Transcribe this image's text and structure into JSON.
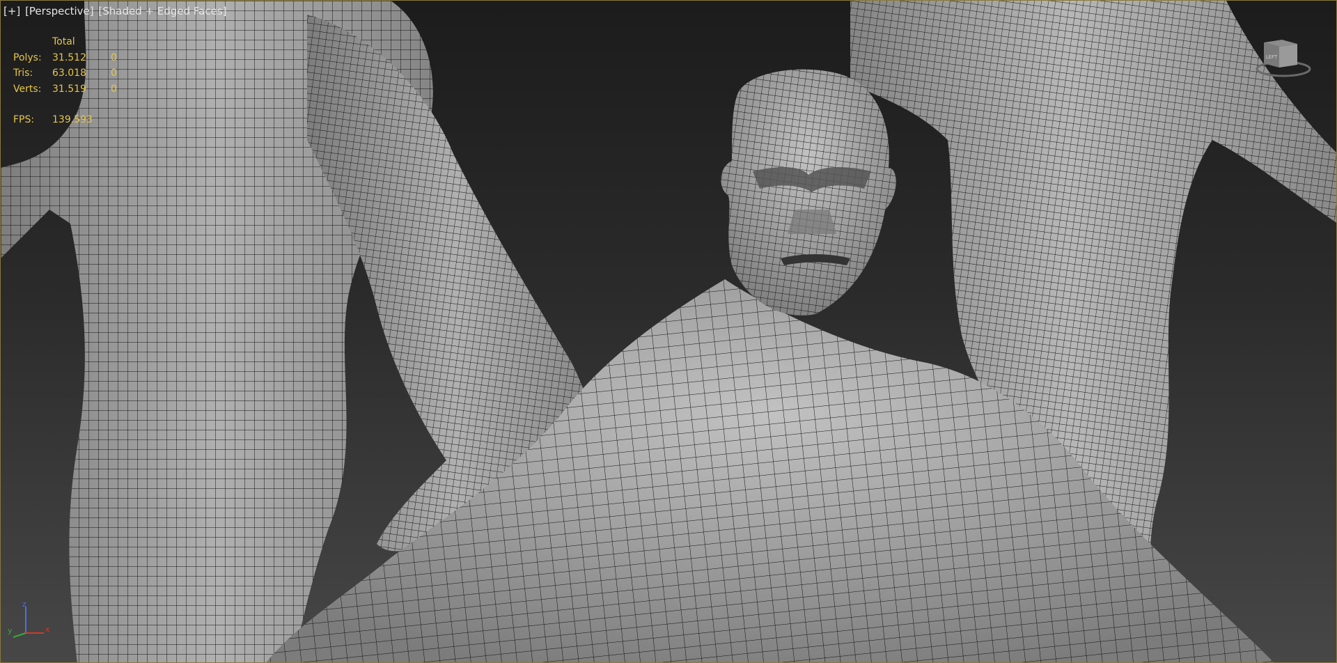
{
  "viewport": {
    "labels": [
      "[+]",
      "[Perspective]",
      "[Shaded + Edged Faces]"
    ]
  },
  "stats": {
    "header": "Total",
    "rows": [
      {
        "label": "Polys:",
        "total": "31.512",
        "selected": "0"
      },
      {
        "label": "Tris:",
        "total": "63.018",
        "selected": "0"
      },
      {
        "label": "Verts:",
        "total": "31.519",
        "selected": "0"
      }
    ],
    "fps_label": "FPS:",
    "fps_value": "139.593"
  },
  "viewcube": {
    "face_label": "LEFT"
  },
  "axis_tripod": {
    "z": "z",
    "x": "x",
    "y": "y"
  },
  "colors": {
    "stats_text": "#e6c64a",
    "border": "#8a7a3a",
    "mesh": "#9c9c9c",
    "wire": "#111111"
  }
}
